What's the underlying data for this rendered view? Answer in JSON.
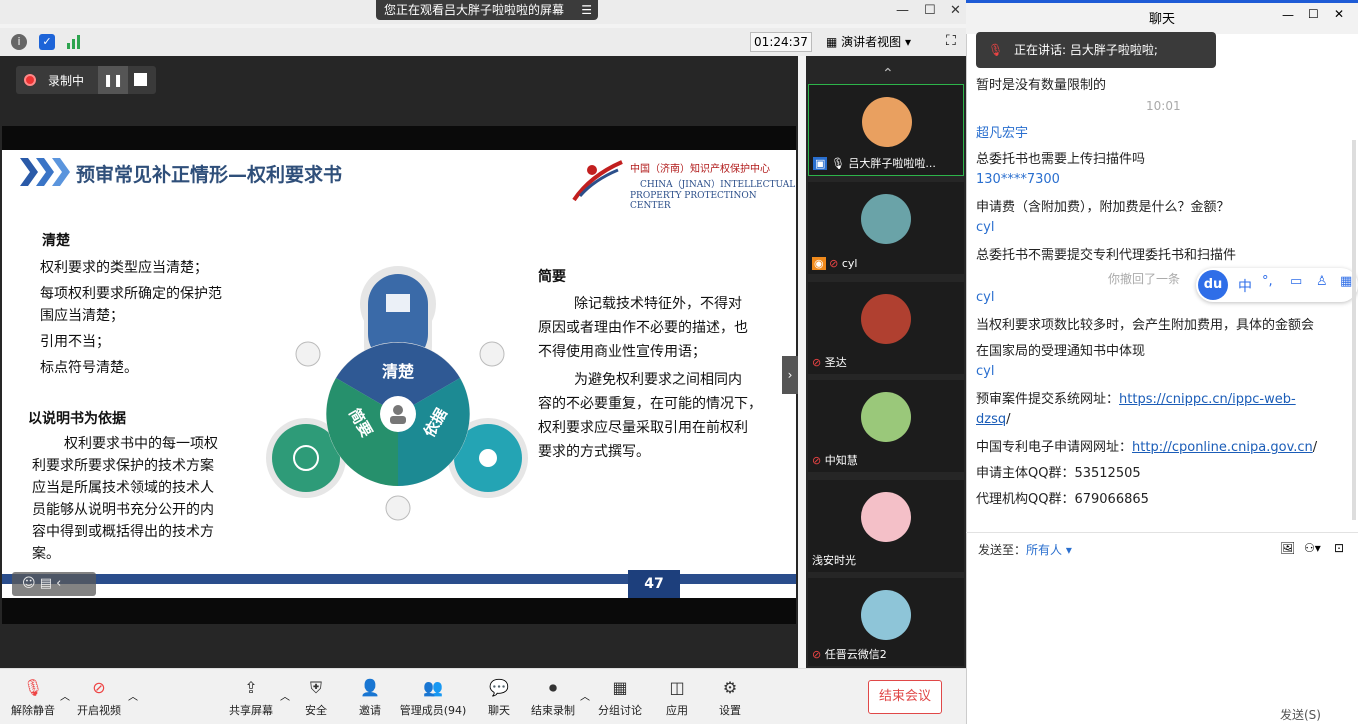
{
  "banner": {
    "text": "您正在观看吕大胖子啦啦啦的屏幕",
    "menu_icon": "menu-icon"
  },
  "toolbar": {
    "timer": "01:24:37",
    "view_mode": "演讲者视图"
  },
  "recording": {
    "label": "录制中"
  },
  "slide": {
    "title": "预审常见补正情形—权利要求书",
    "org_cn": "中国（济南）知识产权保护中心",
    "org_en1": "CHINA（JINAN）INTELLECTUAL",
    "org_en2": "PROPERTY PROTECTINON CENTER",
    "left_heading": "清楚",
    "left_items": [
      "权利要求的类型应当清楚；",
      "每项权利要求所确定的保护范",
      "围应当清楚；",
      "引用不当；",
      "标点符号清楚。"
    ],
    "basis_heading": "以说明书为依据",
    "basis_text": [
      "权利要求书中的每一项权",
      "利要求所要求保护的技术方案",
      "应当是所属技术领域的技术人",
      "员能够从说明书充分公开的内",
      "容中得到或概括得出的技术方",
      "案。"
    ],
    "diagram": {
      "top": "清楚",
      "left": "简要",
      "right": "依据"
    },
    "right_heading": "简要",
    "right_text": [
      "除记载技术特征外，不得对",
      "原因或者理由作不必要的描述，也",
      "不得使用商业性宣传用语；",
      "为避免权利要求之间相同内",
      "容的不必要重复，在可能的情况下，",
      "权利要求应尽量采取引用在前权利",
      "要求的方式撰写。"
    ],
    "page": "47"
  },
  "participants": [
    {
      "name": "吕大胖子啦啦啦...",
      "color": "#e9a060"
    },
    {
      "name": "cyl",
      "color": "#6aa3a8"
    },
    {
      "name": "圣达",
      "color": "#b04030"
    },
    {
      "name": "中知慧",
      "color": "#9ac87a"
    },
    {
      "name": "浅安时光",
      "color": "#f4c0c8"
    },
    {
      "name": "任晋云微信2",
      "color": "#8ec5d8"
    }
  ],
  "bottombar": {
    "mute": "解除静音",
    "video": "开启视频",
    "share": "共享屏幕",
    "security": "安全",
    "invite": "邀请",
    "members": "管理成员(94)",
    "chat": "聊天",
    "end_rec": "结束录制",
    "breakout": "分组讨论",
    "apps": "应用",
    "settings": "设置",
    "end_meeting": "结束会议"
  },
  "chat": {
    "title": "聊天",
    "speaking": "正在讲话: 吕大胖子啦啦啦;",
    "msg0": "暂时是没有数量限制的",
    "time": "10:01",
    "n1": "超凡宏宇",
    "m1": "总委托书也需要上传扫描件吗",
    "n2": "130****7300",
    "m2": "申请费（含附加费），附加费是什么？金额？",
    "n3": "cyl",
    "m3": "总委托书不需要提交专利代理委托书和扫描件",
    "recall": "你撤回了一条",
    "n4": "cyl",
    "m4a": "当权利要求项数比较多时，会产生附加费用，具体的金额会",
    "m4b": "在国家局的受理通知书中体现",
    "n5": "cyl",
    "m5a_prefix": "预审案件提交系统网址：",
    "m5a_link": "https://cnippc.cn/ippc-web-",
    "m5b_link": "dzsq",
    "m5b_suffix": "/",
    "m5c_prefix": "中国专利电子申请网网址：",
    "m5c_link": "http://cponline.cnipa.gov.cn",
    "m5c_suffix": "/",
    "m5d": "申请主体QQ群：53512505",
    "m5e": "代理机构QQ群：679066865",
    "send_to_label": "发送至：",
    "send_to_value": "所有人",
    "send_button": "发送(S)",
    "ime_label": "中"
  }
}
